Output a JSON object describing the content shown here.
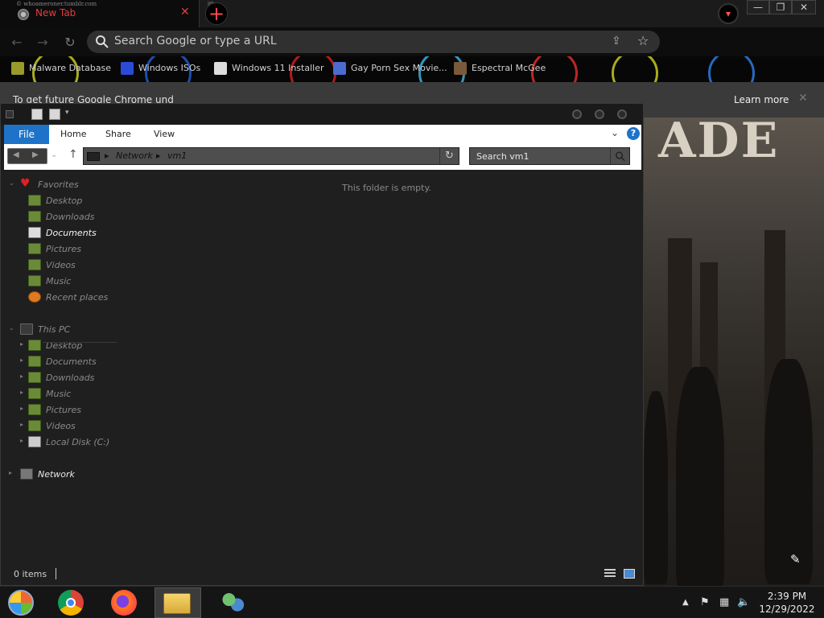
{
  "browser": {
    "tab_tiny_url": "© whoameroner.tumblr.com",
    "tab_title": "New Tab",
    "tab_close": "✕",
    "newtab": "+",
    "tab_tiny_b": "ith",
    "winctl": {
      "minimize": "—",
      "restore": "❐",
      "close": "✕"
    },
    "omnibox_placeholder": "Search Google or type a URL",
    "bookmarks": [
      {
        "label": "Malware Database",
        "icon_color": "#9a9a2a"
      },
      {
        "label": "Windows ISOs",
        "icon_color": "#2b4bd6"
      },
      {
        "label": "Windows 11 Installer",
        "icon_color": "#dddddd"
      },
      {
        "label": "Gay Porn Sex Movie...",
        "icon_color": "#4b6bd0"
      },
      {
        "label": "Espectral McGee",
        "icon_color": "#7a5a3a"
      }
    ],
    "infobar_message": "To get future Google Chrome und",
    "infobar_link": "Learn more",
    "infobar_close": "✕"
  },
  "wallpaper": {
    "text": "ADE"
  },
  "explorer": {
    "ribbon_tabs": [
      "File",
      "Home",
      "Share",
      "View"
    ],
    "ribbon_help": "?",
    "path": [
      "Network",
      "vm1"
    ],
    "search_placeholder": "Search vm1",
    "favorites_label": "Favorites",
    "favorites": [
      "Desktop",
      "Downloads",
      "Documents",
      "Pictures",
      "Videos",
      "Music",
      "Recent places"
    ],
    "thispc_label": "This PC",
    "thispc": [
      "Desktop",
      "Documents",
      "Downloads",
      "Music",
      "Pictures",
      "Videos",
      "Local Disk (C:)"
    ],
    "network_label": "Network",
    "empty_message": "This folder is empty.",
    "status_count": "0 items"
  },
  "taskbar": {
    "apps": [
      "start-orb",
      "chrome",
      "firefox",
      "file-explorer",
      "network-users"
    ],
    "time": "2:39 PM",
    "date": "12/29/2022"
  },
  "colors": {
    "accent": "#1e73c9",
    "tab_title": "#e53c3c",
    "folder": "#6b8a38"
  }
}
